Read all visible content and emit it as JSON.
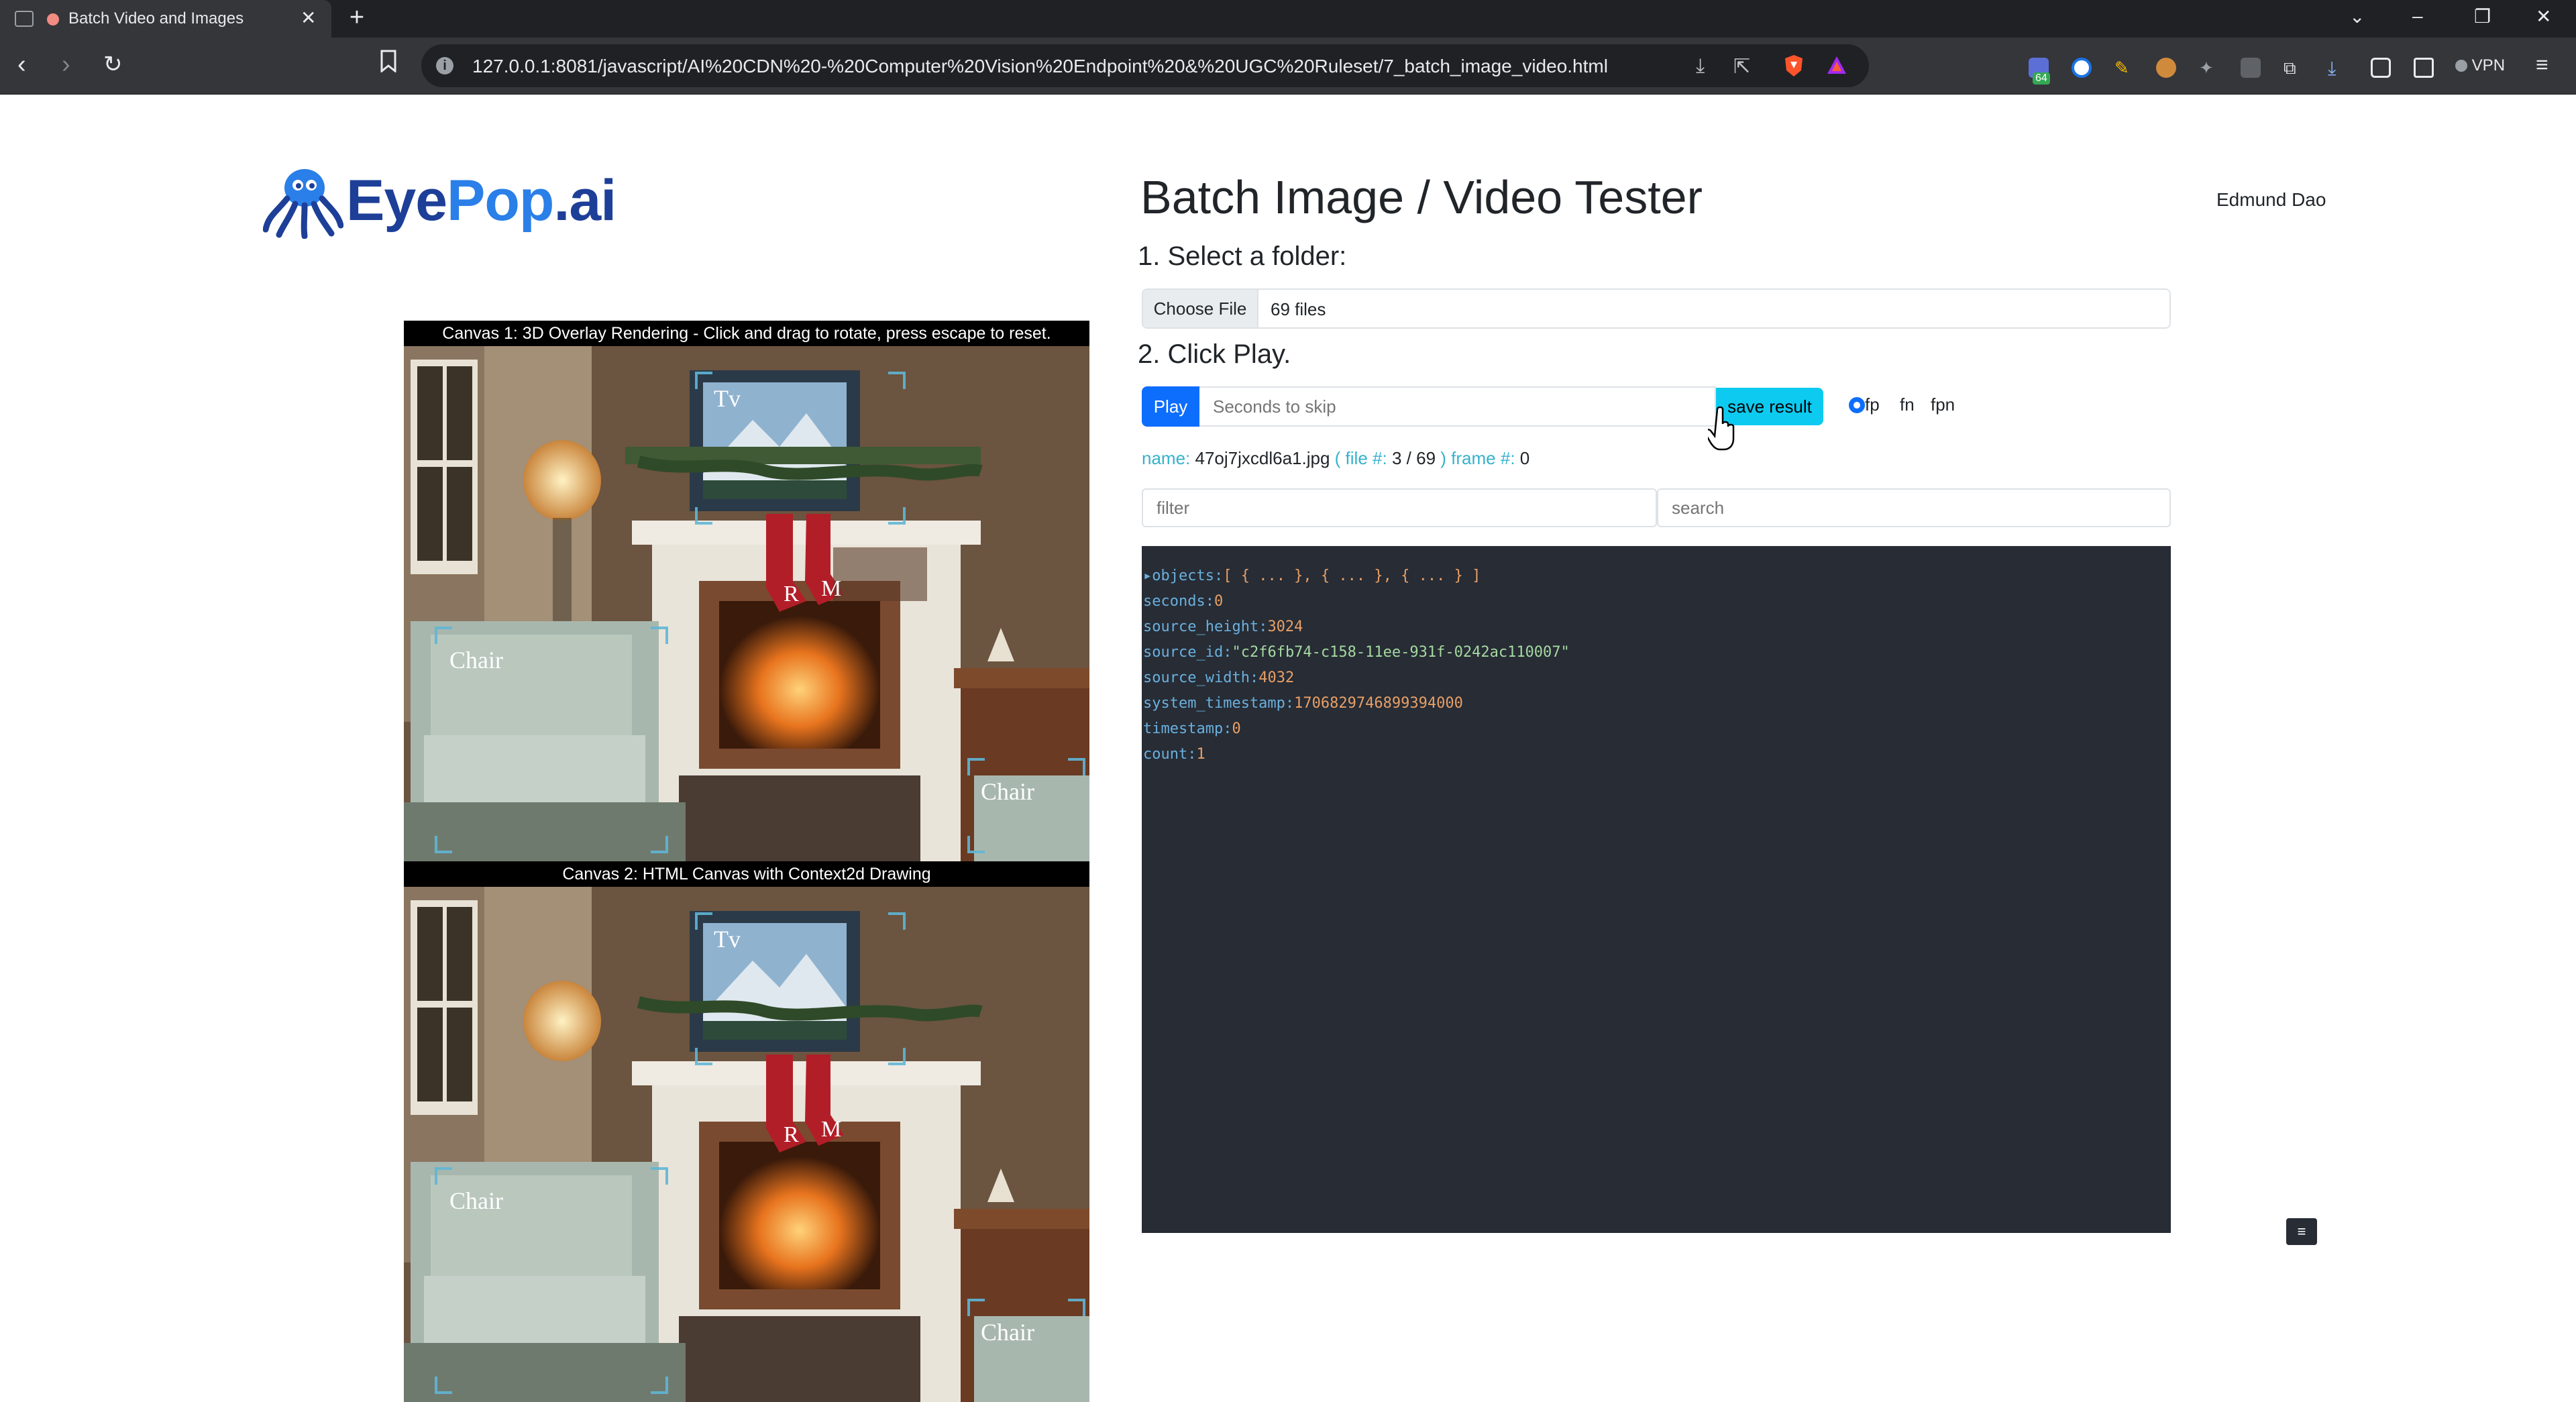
{
  "browser": {
    "tab_title": "Batch Video and Images",
    "tab_close": "✕",
    "new_tab": "+",
    "url": "127.0.0.1:8081/javascript/AI%20CDN%20-%20Computer%20Vision%20Endpoint%20&%20UGC%20Ruleset/7_batch_image_video.html",
    "vpn_label": "VPN",
    "extension_badge": "64",
    "icons": [
      "back-icon",
      "forward-icon",
      "reload-icon",
      "bookmark-icon",
      "download-icon",
      "share-icon",
      "brave-shield-icon",
      "rewards-icon",
      "extensions-icon",
      "sidebar-icon",
      "wallet-icon",
      "menu-icon"
    ]
  },
  "header": {
    "logo_part1": "Eye",
    "logo_part2": "Pop",
    "logo_part3": ".ai",
    "title": "Batch Image / Video Tester",
    "user_name": "Edmund Dao"
  },
  "step1": {
    "label": "1. Select a folder:",
    "choose_button": "Choose File",
    "file_count": "69 files"
  },
  "step2": {
    "label": "2. Click Play.",
    "play_button": "Play",
    "skip_placeholder": "Seconds to skip",
    "save_button": "save result",
    "radios": [
      {
        "label": "fp",
        "checked": true
      },
      {
        "label": "fn",
        "checked": false
      },
      {
        "label": "fpn",
        "checked": false
      }
    ]
  },
  "status": {
    "name_label": "name:",
    "name_value": "47oj7jxcdl6a1.jpg",
    "file_open": "( file #:",
    "file_index": "3",
    "file_sep": "/",
    "file_total": "69",
    "file_close": ")",
    "frame_label": "frame #:",
    "frame_value": "0"
  },
  "filters": {
    "filter_placeholder": "filter",
    "search_placeholder": "search"
  },
  "json_view": {
    "objects_key": "objects",
    "objects_value": "[ { ... }, { ... }, { ... } ]",
    "rows": [
      {
        "key": "seconds",
        "value": "0",
        "kind": "number"
      },
      {
        "key": "source_height",
        "value": "3024",
        "kind": "number"
      },
      {
        "key": "source_id",
        "value": "\"c2f6fb74-c158-11ee-931f-0242ac110007\"",
        "kind": "string"
      },
      {
        "key": "source_width",
        "value": "4032",
        "kind": "number"
      },
      {
        "key": "system_timestamp",
        "value": "1706829746899394000",
        "kind": "number"
      },
      {
        "key": "timestamp",
        "value": "0",
        "kind": "number"
      },
      {
        "key": "count",
        "value": "1",
        "kind": "number"
      }
    ]
  },
  "canvases": {
    "canvas1_label": "Canvas 1: 3D Overlay Rendering - Click and drag to rotate, press escape to reset.",
    "canvas2_label": "Canvas 2: HTML Canvas with Context2d Drawing",
    "labels": {
      "tv": "Tv",
      "chair": "Chair",
      "stocking_r": "R",
      "stocking_m": "M"
    }
  },
  "small_menu": "≡",
  "colors": {
    "primary": "#0d6efd",
    "info": "#0dcaf0",
    "panel_bg": "#272c35",
    "logo_dark": "#1d3f98",
    "logo_light": "#2b7fe8"
  }
}
